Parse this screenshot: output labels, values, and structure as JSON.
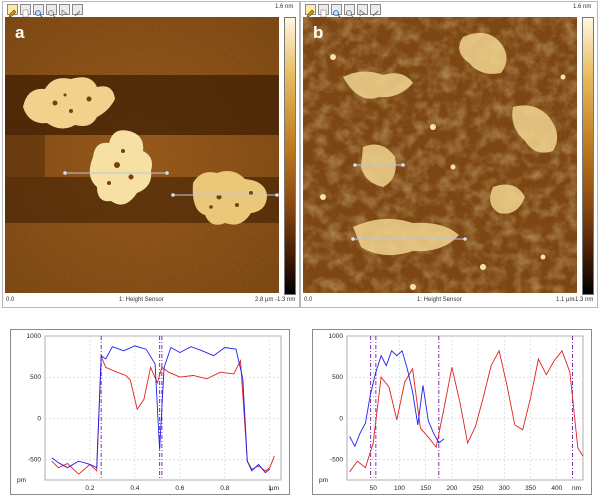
{
  "panels": [
    {
      "label": "a",
      "channel": "1: Height Sensor",
      "x_start": "0.0",
      "x_end": "2.8 µm",
      "z_max": "1.6 nm",
      "z_min": "-1.3 nm"
    },
    {
      "label": "b",
      "channel": "1: Height Sensor",
      "x_start": "0.0",
      "x_end": "1.1 µm",
      "z_max": "1.6 nm",
      "z_min": "-1.3 nm"
    }
  ],
  "toolbar_icons": [
    "pencil-icon",
    "page-icon",
    "zoom-in-icon",
    "zoom-out-icon",
    "cursor-icon",
    "tool-icon"
  ],
  "colors": {
    "afm_dark": "#3a1c03",
    "afm_mid": "#8a4a12",
    "afm_bright": "#f4dca0",
    "trace_red": "#e02020",
    "trace_blue": "#2020ee",
    "cursor": "#7a2fb0"
  },
  "chart_data": [
    {
      "type": "line",
      "title": "",
      "xlabel": "µm",
      "ylabel": "pm",
      "ylim": [
        -750,
        1000
      ],
      "xlim": [
        0,
        1.05
      ],
      "y_ticks": [
        "1000",
        "500",
        "0",
        "-500"
      ],
      "x_ticks": [
        "0.2",
        "0.4",
        "0.6",
        "0.8",
        "1"
      ],
      "x_tick_values": [
        0.2,
        0.4,
        0.6,
        0.8,
        1.0
      ],
      "cursors": [
        0.25,
        0.51,
        0.52
      ],
      "series": [
        {
          "color": "#e02020",
          "x": [
            0.03,
            0.06,
            0.1,
            0.15,
            0.2,
            0.23,
            0.25,
            0.27,
            0.32,
            0.36,
            0.38,
            0.41,
            0.44,
            0.47,
            0.5,
            0.52,
            0.55,
            0.6,
            0.66,
            0.72,
            0.78,
            0.84,
            0.87,
            0.9,
            0.92,
            0.95,
            0.98,
            1.0,
            1.02
          ],
          "y": [
            -520,
            -600,
            -550,
            -680,
            -560,
            -640,
            750,
            620,
            560,
            520,
            460,
            110,
            230,
            620,
            430,
            620,
            560,
            500,
            520,
            480,
            560,
            540,
            700,
            -520,
            -620,
            -580,
            -640,
            -600,
            -460
          ]
        },
        {
          "color": "#2020ee",
          "x": [
            0.03,
            0.06,
            0.1,
            0.15,
            0.2,
            0.23,
            0.25,
            0.27,
            0.3,
            0.35,
            0.4,
            0.45,
            0.49,
            0.51,
            0.53,
            0.56,
            0.6,
            0.65,
            0.7,
            0.75,
            0.8,
            0.85,
            0.88,
            0.9,
            0.92,
            0.95,
            0.98,
            1.0
          ],
          "y": [
            -480,
            -540,
            -600,
            -520,
            -560,
            -600,
            760,
            720,
            870,
            820,
            880,
            840,
            660,
            -380,
            620,
            860,
            800,
            870,
            820,
            760,
            860,
            840,
            480,
            -520,
            -640,
            -560,
            -660,
            -620
          ]
        }
      ]
    },
    {
      "type": "line",
      "title": "",
      "xlabel": "nm",
      "ylabel": "pm",
      "ylim": [
        -750,
        1000
      ],
      "xlim": [
        0,
        450
      ],
      "y_ticks": [
        "1000",
        "500",
        "0",
        "-500"
      ],
      "x_ticks": [
        "50",
        "100",
        "150",
        "200",
        "250",
        "300",
        "350",
        "400"
      ],
      "x_tick_values": [
        50,
        100,
        150,
        200,
        250,
        300,
        350,
        400
      ],
      "cursors": [
        45,
        55,
        175,
        430
      ],
      "series": [
        {
          "color": "#e02020",
          "x": [
            5,
            20,
            35,
            50,
            65,
            80,
            95,
            110,
            125,
            140,
            155,
            170,
            185,
            200,
            215,
            230,
            245,
            260,
            275,
            290,
            305,
            320,
            335,
            350,
            365,
            380,
            395,
            410,
            425,
            440,
            450
          ],
          "y": [
            -650,
            -520,
            -600,
            -300,
            500,
            380,
            -20,
            440,
            600,
            -120,
            -230,
            -350,
            120,
            620,
            200,
            -300,
            -100,
            260,
            640,
            820,
            400,
            -80,
            -140,
            250,
            720,
            530,
            700,
            820,
            560,
            -360,
            -460
          ]
        },
        {
          "color": "#2020ee",
          "x": [
            5,
            15,
            25,
            35,
            45,
            55,
            65,
            75,
            85,
            95,
            105,
            115,
            125,
            135,
            145,
            155,
            165,
            175,
            185
          ],
          "y": [
            -220,
            -340,
            -180,
            -60,
            300,
            560,
            760,
            640,
            820,
            760,
            820,
            600,
            320,
            -80,
            400,
            -30,
            -180,
            -300,
            -250
          ]
        }
      ]
    }
  ]
}
